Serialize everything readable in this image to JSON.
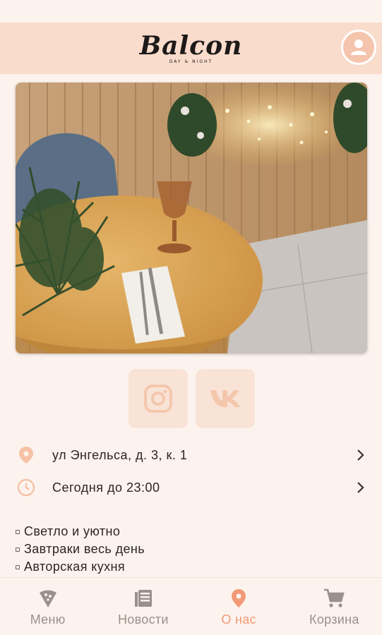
{
  "header": {
    "logo_main": "Balcon",
    "logo_sub": "DAY & NIGHT",
    "profile_icon": "user-profile-icon"
  },
  "hero": {
    "image": "restaurant-table-photo"
  },
  "social": [
    {
      "name": "instagram",
      "icon": "instagram-icon"
    },
    {
      "name": "vk",
      "icon": "vk-icon"
    }
  ],
  "info": {
    "address": "ул Энгельса, д. 3, к. 1",
    "hours": "Сегодня до 23:00"
  },
  "features": [
    "Светло и уютно",
    "Завтраки весь день",
    "Авторская кухня"
  ],
  "nav": {
    "menu": "Меню",
    "news": "Новости",
    "about": "О нас",
    "cart": "Корзина",
    "active": "about"
  },
  "colors": {
    "header_bg": "#f9dccc",
    "accent": "#f29a78",
    "page_bg": "#fdf3ee",
    "icon_muted": "#9a908c"
  }
}
